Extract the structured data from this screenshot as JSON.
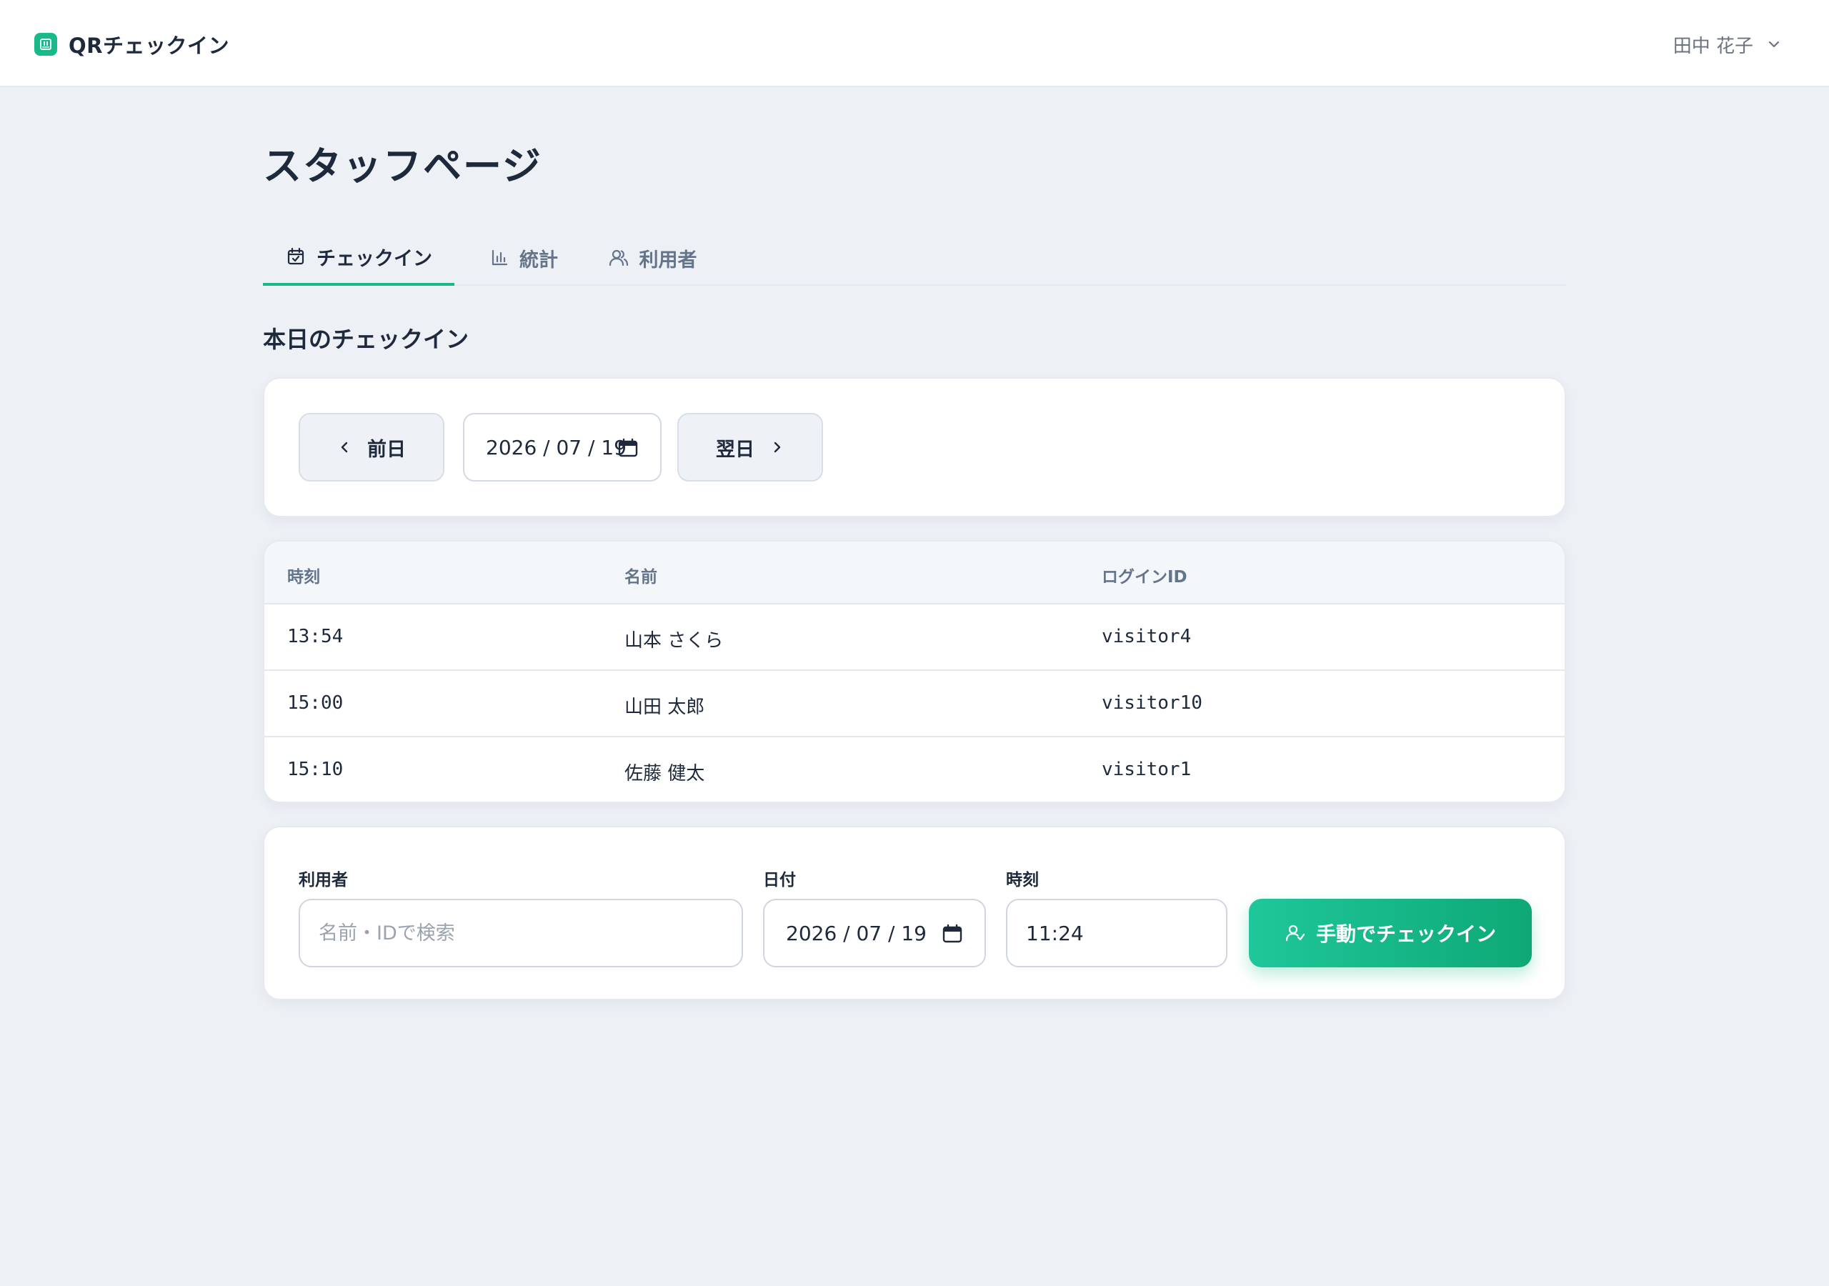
{
  "app": {
    "name": "QRチェックイン",
    "user_name": "田中 花子",
    "accent_color": "#19b98a"
  },
  "page": {
    "title": "スタッフページ",
    "tabs": [
      {
        "label": "チェックイン",
        "icon": "calendar-check-icon",
        "active": true
      },
      {
        "label": "統計",
        "icon": "bar-chart-icon",
        "active": false
      },
      {
        "label": "利用者",
        "icon": "users-icon",
        "active": false
      }
    ],
    "section_title": "本日のチェックイン"
  },
  "date_nav": {
    "prev_label": "前日",
    "date_value": "2026 / 07 / 19",
    "next_label": "翌日"
  },
  "table": {
    "headers": [
      "時刻",
      "名前",
      "ログインID"
    ],
    "rows": [
      [
        "13:54",
        "山本 さくら",
        "visitor4"
      ],
      [
        "15:00",
        "山田 太郎",
        "visitor10"
      ],
      [
        "15:10",
        "佐藤 健太",
        "visitor1"
      ]
    ]
  },
  "manual_form": {
    "user_label": "利用者",
    "user_placeholder": "名前・IDで検索",
    "date_label": "日付",
    "date_value": "2026 / 07 / 19",
    "time_label": "時刻",
    "time_value": "11:24",
    "submit_label": "手動でチェックイン"
  }
}
